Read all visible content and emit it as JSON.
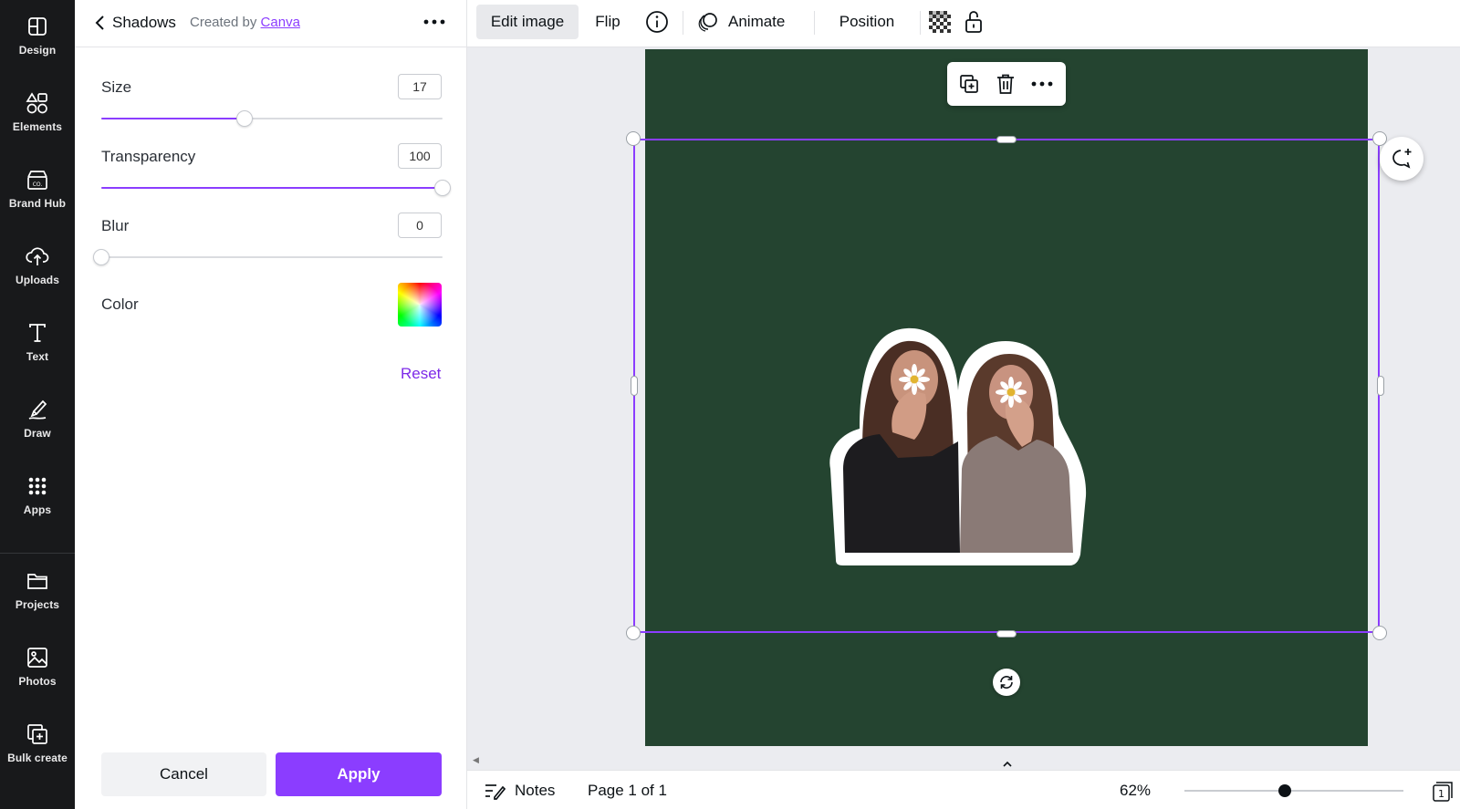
{
  "rail": {
    "items": [
      {
        "label": "Design",
        "icon": "design-icon"
      },
      {
        "label": "Elements",
        "icon": "elements-icon"
      },
      {
        "label": "Brand Hub",
        "icon": "brand-hub-icon"
      },
      {
        "label": "Uploads",
        "icon": "upload-cloud-icon"
      },
      {
        "label": "Text",
        "icon": "text-icon"
      },
      {
        "label": "Draw",
        "icon": "draw-icon"
      },
      {
        "label": "Apps",
        "icon": "apps-grid-icon"
      },
      {
        "label": "Projects",
        "icon": "folder-icon"
      },
      {
        "label": "Photos",
        "icon": "photo-icon"
      },
      {
        "label": "Bulk create",
        "icon": "bulk-create-icon"
      }
    ]
  },
  "panel": {
    "title": "Shadows",
    "created_by_prefix": "Created by",
    "created_by_link": "Canva",
    "size": {
      "label": "Size",
      "value": "17",
      "fraction": 0.42
    },
    "transparency": {
      "label": "Transparency",
      "value": "100",
      "fraction": 1.0
    },
    "blur": {
      "label": "Blur",
      "value": "0",
      "fraction": 0.0
    },
    "color": {
      "label": "Color"
    },
    "reset_label": "Reset",
    "cancel_label": "Cancel",
    "apply_label": "Apply"
  },
  "toolbar": {
    "edit_image": "Edit image",
    "flip": "Flip",
    "animate": "Animate",
    "position": "Position"
  },
  "colors": {
    "accent": "#8b3dff",
    "rail_bg": "#18191b",
    "artboard_bg": "#244430"
  },
  "bottombar": {
    "notes_label": "Notes",
    "page_label": "Page 1 of 1",
    "zoom_label": "62%",
    "zoom_fraction": 0.46,
    "pages_count": "1"
  }
}
